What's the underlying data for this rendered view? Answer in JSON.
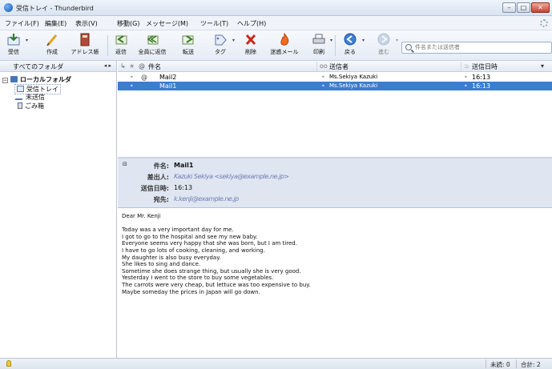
{
  "window": {
    "title": "受信トレイ - Thunderbird",
    "controls": [
      "–",
      "□",
      "✕"
    ]
  },
  "menu": [
    "ファイル(F)",
    "編集(E)",
    "表示(V)",
    "移動(G)",
    "メッセージ(M)",
    "ツール(T)",
    "ヘルプ(H)"
  ],
  "toolbar": {
    "get_mail": "受信",
    "write": "作成",
    "address_book": "アドレス帳",
    "reply": "返信",
    "reply_all": "全員に返信",
    "forward": "転送",
    "tag": "タグ",
    "delete": "削除",
    "junk": "迷惑メール",
    "print": "印刷",
    "back": "戻る",
    "next": "進む",
    "search_placeholder": "件名または送信者"
  },
  "folders": {
    "header": "すべてのフォルダ",
    "header_arrows": "◂ ▸",
    "root": "ローカルフォルダ",
    "items": [
      "受信トレイ",
      "未送信",
      "ごみ箱"
    ]
  },
  "thread": {
    "columns": {
      "subject": "件名",
      "sender": "送信者",
      "date": "送信日時"
    },
    "rows": [
      {
        "subject": "Mail2",
        "sender": "Ms.Sekiya Kazuki",
        "date": "16:13",
        "selected": false
      },
      {
        "subject": "Mail1",
        "sender": "Ms.Sekiya Kazuki",
        "date": "16:13",
        "selected": true
      }
    ]
  },
  "message": {
    "labels": {
      "subject": "件名:",
      "from": "差出人:",
      "date": "送信日時:",
      "to": "宛先:"
    },
    "subject": "Mail1",
    "from": "Kazuki Sekiya <sekiya@example.ne.jp>",
    "date": "16:13",
    "to": "k.kenji@example.ne.jp",
    "body": [
      "Dear Mr. Kenji",
      "",
      "Today was a very important day for me.",
      "I got to go to the hospital and see my new baby.",
      "Everyone seems very happy that she was born, but I am tired.",
      "I have to go lots of cooking, cleaning, and working.",
      "My daughter is also busy everyday.",
      "She likes to sing and dance.",
      "Sometime she does strange thing, but usually she is very good.",
      "Yesterday I went to the store to buy some vegetables.",
      "The carrots were very cheap, but lettuce was too expensive to buy.",
      "Maybe someday the prices in Japan will go down."
    ]
  },
  "status": {
    "unread": "未読: 0",
    "total": "合計: 2"
  },
  "colors": {
    "selection": "#3b7dcf",
    "header_bg": "#dfe6f1"
  }
}
